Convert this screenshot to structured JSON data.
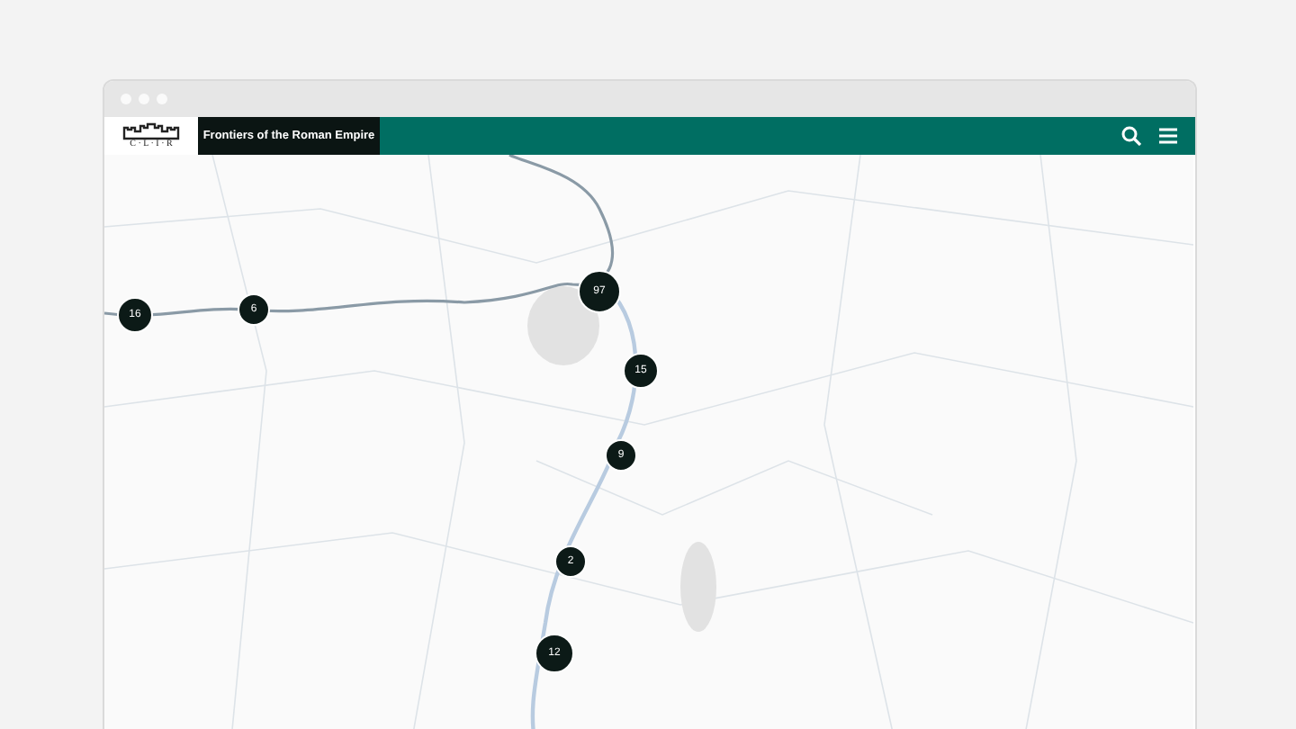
{
  "header": {
    "logo_text": "C · L · I · R",
    "title": "Frontiers of the Roman Empire"
  },
  "markers": [
    {
      "count": "16"
    },
    {
      "count": "6"
    },
    {
      "count": "97"
    },
    {
      "count": "15"
    },
    {
      "count": "9"
    },
    {
      "count": "2"
    },
    {
      "count": "12"
    }
  ]
}
